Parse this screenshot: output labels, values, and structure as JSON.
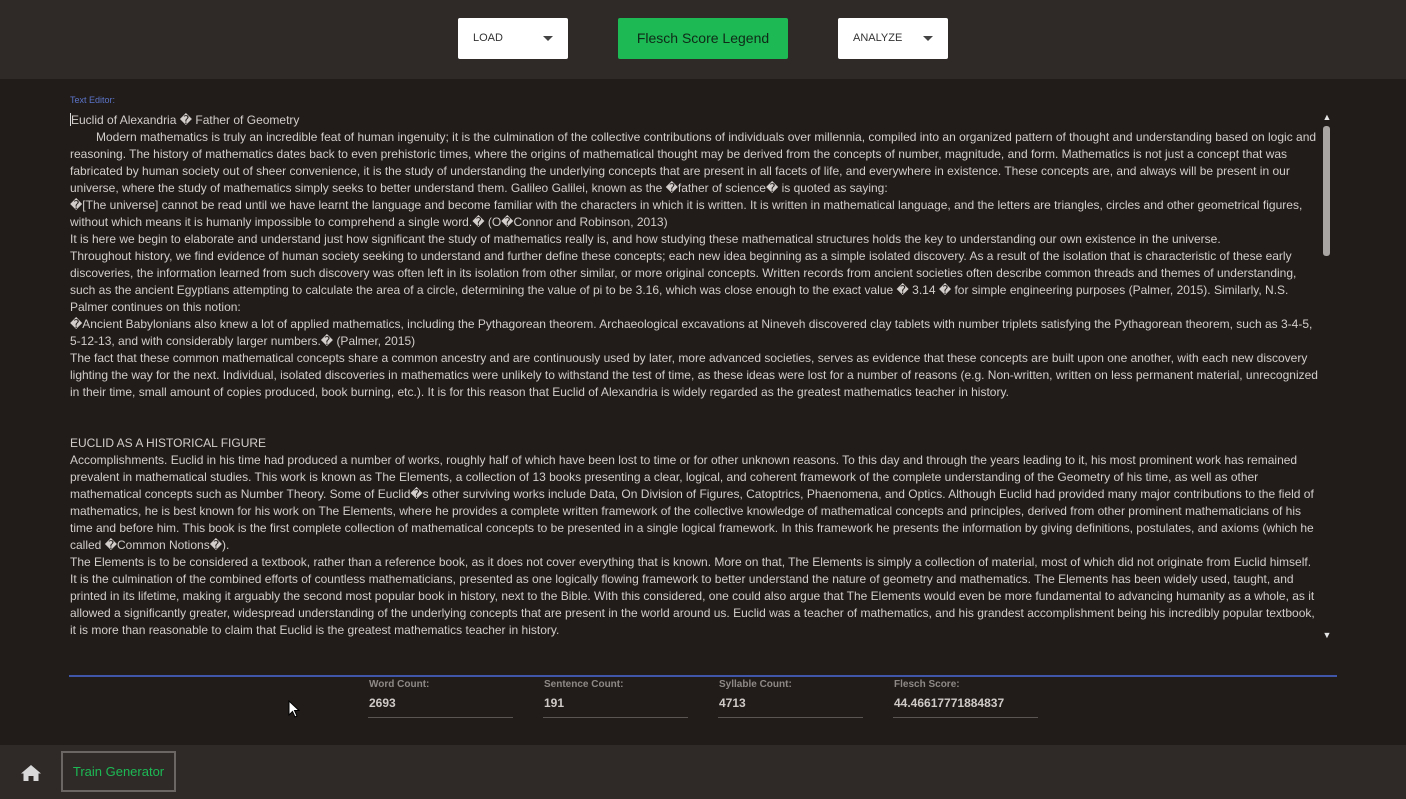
{
  "toolbar": {
    "load_label": "LOAD",
    "legend_label": "Flesch Score Legend",
    "analyze_label": "ANALYZE"
  },
  "editor": {
    "label": "Text Editor:",
    "paragraphs": [
      {
        "text": "Euclid of Alexandria � Father of Geometry",
        "indent": false
      },
      {
        "text": "Modern mathematics is truly an incredible feat of human ingenuity; it is the culmination of the collective contributions of individuals over millennia, compiled into an organized pattern of thought and understanding based on logic and reasoning. The history of mathematics dates back to even prehistoric times, where the origins of mathematical thought may be derived from the concepts of number, magnitude, and form. Mathematics is not just a concept that was fabricated by human society out of sheer convenience, it is the study of understanding the underlying concepts that are present in all facets of life, and everywhere in existence. These concepts are, and always will be present in our universe, where the study of mathematics simply seeks to better understand them. Galileo Galilei, known as the �father of science� is quoted as saying:",
        "indent": true
      },
      {
        "text": "�[The universe] cannot be read until we have learnt the language and become familiar with the characters in which it is written. It is written in mathematical language, and the letters are triangles, circles and other geometrical figures, without which means it is humanly impossible to comprehend a single word.� (O�Connor and Robinson, 2013)",
        "indent": false
      },
      {
        "text": "It is here we begin to elaborate and understand just how significant the study of mathematics really is, and how studying these mathematical structures holds the key to understanding our own existence in the universe.",
        "indent": false
      },
      {
        "text": "Throughout history, we find evidence of human society seeking to understand and further define these concepts; each new idea beginning as a simple isolated discovery. As a result of the isolation that is characteristic of these early discoveries, the information learned from such discovery was often left in its isolation from other similar, or more original concepts. Written records from ancient societies often describe common threads and themes of understanding, such as the ancient Egyptians attempting to calculate the area of a circle, determining the value of pi to be 3.16, which was close enough to the exact value � 3.14 � for simple engineering purposes (Palmer, 2015). Similarly, N.S. Palmer continues on this notion:",
        "indent": false
      },
      {
        "text": "�Ancient Babylonians also knew a lot of applied mathematics, including the Pythagorean theorem. Archaeological excavations at Nineveh discovered clay tablets with number triplets satisfying the Pythagorean theorem, such as 3-4-5, 5-12-13, and with considerably larger numbers.� (Palmer, 2015)",
        "indent": false
      },
      {
        "text": "The fact that these common mathematical concepts share a common ancestry and are continuously used by later, more advanced societies, serves as evidence that these concepts are built upon one another, with each new discovery lighting the way for the next. Individual, isolated discoveries in mathematics were unlikely to withstand the test of time, as these ideas were lost for a number of reasons (e.g. Non-written, written on less permanent material, unrecognized in their time, small amount of copies produced, book burning, etc.). It is for this reason that Euclid of Alexandria is widely regarded as the greatest mathematics teacher in history.",
        "indent": false
      },
      {
        "text": "",
        "indent": false,
        "gap": true
      },
      {
        "text": "EUCLID AS A HISTORICAL FIGURE",
        "indent": false
      },
      {
        "text": "Accomplishments. Euclid in his time had produced a number of works, roughly half of which have been lost to time or for other unknown reasons. To this day and through the years leading to it, his most prominent work has remained prevalent in mathematical studies. This work is known as The Elements, a collection of 13 books presenting a clear, logical, and coherent framework of the complete understanding of the Geometry of his time, as well as other mathematical concepts such as Number Theory. Some of Euclid�s other surviving works include Data, On Division of Figures, Catoptrics, Phaenomena, and Optics. Although Euclid had provided many major contributions to the field of mathematics, he is best known for his work on The Elements, where he provides a complete written framework of the collective knowledge of mathematical concepts and principles, derived from other prominent mathematicians of his time and before him. This book is the first complete collection of mathematical concepts to be presented in a single logical framework. In this framework he presents the information by giving definitions, postulates, and axioms (which he called �Common Notions�).",
        "indent": false
      },
      {
        "text": "The Elements is to be considered a textbook, rather than a reference book, as it does not cover everything that is known. More on that, The Elements is simply a collection of material, most of which did not originate from Euclid himself. It is the culmination of the combined efforts of countless mathematicians, presented as one logically flowing framework to better understand the nature of geometry and mathematics. The Elements has been widely used, taught, and printed in its lifetime, making it arguably the second most popular book in history, next to the Bible. With this considered, one could also argue that The Elements would even be more fundamental to advancing humanity as a whole, as it allowed a significantly greater, widespread understanding of the underlying concepts that are present in the world around us. Euclid was a teacher of mathematics, and his grandest accomplishment being his incredibly popular textbook, it is more than reasonable to claim that Euclid is the greatest mathematics teacher in history.",
        "indent": false
      }
    ]
  },
  "stats": {
    "word_count_label": "Word Count:",
    "word_count": "2693",
    "sentence_count_label": "Sentence Count:",
    "sentence_count": "191",
    "syllable_count_label": "Syllable Count:",
    "syllable_count": "4713",
    "flesch_label": "Flesch Score:",
    "flesch_score": "44.46617771884837"
  },
  "footer": {
    "train_label": "Train Generator"
  },
  "icons": {
    "home": "home-icon",
    "dropdown": "caret-down-icon",
    "scroll_up": "arrow-up-icon",
    "scroll_down": "arrow-down-icon",
    "cursor": "mouse-pointer-icon"
  },
  "colors": {
    "accent_green": "#1db954",
    "accent_blue": "#4056a8",
    "background": "#211c1a",
    "bar": "#2f2a28"
  }
}
